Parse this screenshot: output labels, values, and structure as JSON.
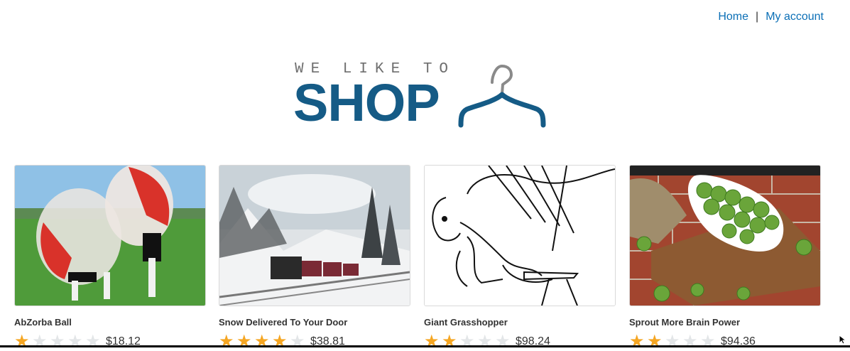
{
  "nav": {
    "home": "Home",
    "separator": "|",
    "account": "My account"
  },
  "logo": {
    "tagline": "WE LIKE TO",
    "word": "SHOP",
    "icon": "hanger-icon"
  },
  "products": [
    {
      "name": "AbZorba Ball",
      "rating": 1,
      "price": "$18.12",
      "image": "bubble-football-image"
    },
    {
      "name": "Snow Delivered To Your Door",
      "rating": 4,
      "price": "$38.81",
      "image": "snow-train-image"
    },
    {
      "name": "Giant Grasshopper",
      "rating": 2,
      "price": "$98.24",
      "image": "grasshopper-sketch-image"
    },
    {
      "name": "Sprout More Brain Power",
      "rating": 2,
      "price": "$94.36",
      "image": "brussels-sprouts-image"
    }
  ],
  "colors": {
    "link": "#0b6fb6",
    "brand": "#155b86",
    "star_on": "#f5a623",
    "star_off": "#e3e6e8"
  }
}
